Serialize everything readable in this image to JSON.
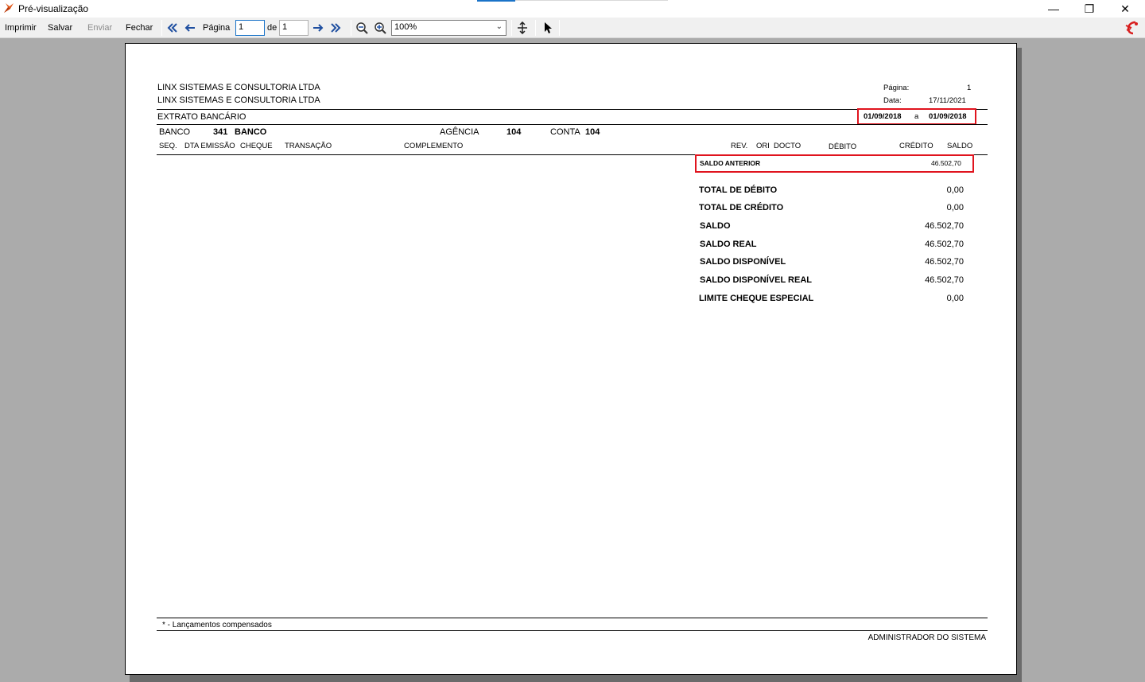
{
  "window": {
    "title": "Pré-visualização",
    "controls": {
      "minimize": "—",
      "maximize": "❐",
      "close": "✕"
    }
  },
  "toolbar": {
    "print": "Imprimir",
    "save": "Salvar",
    "send": "Enviar",
    "close": "Fechar",
    "page_label": "Página",
    "page_value": "1",
    "of_label": "de",
    "total_pages": "1",
    "zoom": "100%",
    "icons": [
      "first-page-icon",
      "prev-page-icon",
      "next-page-icon",
      "last-page-icon",
      "zoom-out-icon",
      "zoom-in-icon",
      "move-icon",
      "pointer-icon"
    ]
  },
  "report": {
    "company_1": "LINX SISTEMAS E CONSULTORIA LTDA",
    "company_2": "LINX SISTEMAS E CONSULTORIA LTDA",
    "page_label": "Página:",
    "page_value": "1",
    "date_label": "Data:",
    "date_value": "17/11/2021",
    "title": "EXTRATO BANCÁRIO",
    "period_start": "01/09/2018",
    "period_sep": "a",
    "period_end": "01/09/2018",
    "bank_label": "BANCO",
    "bank_code": "341",
    "bank_name": "BANCO",
    "agency_label": "AGÊNCIA",
    "agency_value": "104",
    "account_label": "CONTA",
    "account_value": "104",
    "columns": {
      "seq": "SEQ.",
      "emission": "DTA EMISSÃO",
      "check": "CHEQUE",
      "transaction": "TRANSAÇÃO",
      "complement": "COMPLEMENTO",
      "rev": "REV.",
      "ori": "ORI",
      "doc": "DOCTO",
      "debit": "DÉBITO",
      "credit": "CRÉDITO",
      "balance": "SALDO"
    },
    "previous_balance_label": "SALDO ANTERIOR",
    "previous_balance_value": "46.502,70",
    "totals": [
      {
        "label": "TOTAL DE DÉBITO",
        "value": "0,00"
      },
      {
        "label": "TOTAL DE CRÉDITO",
        "value": "0,00"
      },
      {
        "label": "SALDO",
        "value": "46.502,70"
      },
      {
        "label": "SALDO REAL",
        "value": "46.502,70"
      },
      {
        "label": "SALDO DISPONÍVEL",
        "value": "46.502,70"
      },
      {
        "label": "SALDO DISPONÍVEL REAL",
        "value": "46.502,70"
      },
      {
        "label": "LIMITE CHEQUE ESPECIAL",
        "value": "0,00"
      }
    ],
    "footer_note": "* - Lançamentos compensados",
    "footer_user": "ADMINISTRADOR DO SISTEMA"
  },
  "colors": {
    "highlight": "#e0141e",
    "workspace": "#ababab",
    "icon_blue": "#1f4fa0"
  }
}
